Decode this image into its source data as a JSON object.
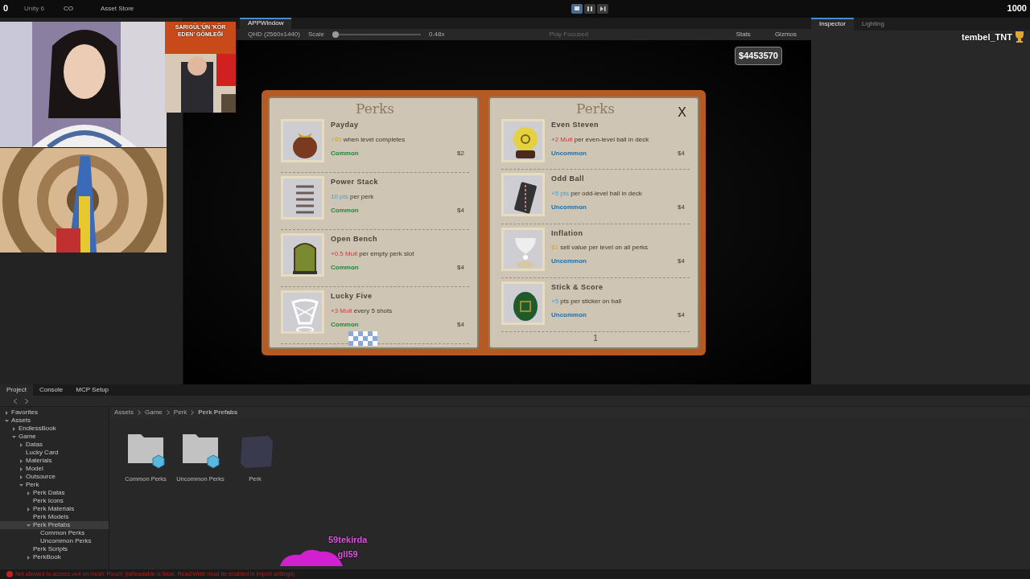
{
  "toolbar": {
    "product": "Unity 6",
    "account": "CO",
    "store": "Asset Store",
    "play_buttons": [
      {
        "selected": true
      },
      {
        "selected": false
      },
      {
        "selected": false
      }
    ]
  },
  "stream": {
    "left_counter": "0",
    "right_counter": "1000",
    "viewer": "tembel_TNT",
    "news_caption": "SARIGÜL'ÜN 'KÖR EDEN' GÖMLEĞİ",
    "follower_lines": [
      "59tekirda",
      "gll59"
    ]
  },
  "game_view": {
    "tab": "APPWindow",
    "resolution": "QHD (2560x1440)",
    "scale_label": "Scale",
    "scale": {
      "level": 0.0
    },
    "scale_reading": "0.48x",
    "play_mode": "Play Focused",
    "stats": "Stats",
    "gizmos": "Gizmos",
    "money": "$4453570"
  },
  "book": {
    "close": "X",
    "pages": [
      {
        "title": "Perks",
        "perks": [
          {
            "name": "Payday",
            "effect": {
              "kind": "money",
              "value": "+$5",
              "rest": " when level completes"
            },
            "rarity": "Common",
            "price": "$2"
          },
          {
            "name": "Power Stack",
            "effect": {
              "kind": "pts",
              "value": "10 pts",
              "rest": " per perk"
            },
            "rarity": "Common",
            "price": "$4"
          },
          {
            "name": "Open Bench",
            "effect": {
              "kind": "mult",
              "value": "+0.5 Mult",
              "rest": " per empty perk slot"
            },
            "rarity": "Common",
            "price": "$4"
          },
          {
            "name": "Lucky Five",
            "effect": {
              "kind": "mult",
              "value": "+3 Mult",
              "rest": " every 5 shots"
            },
            "rarity": "Common",
            "price": "$4"
          }
        ]
      },
      {
        "title": "Perks",
        "page_number": "1",
        "perks": [
          {
            "name": "Even Steven",
            "effect": {
              "kind": "mult",
              "value": "+2 Mult",
              "rest": " per even-level ball in deck"
            },
            "rarity": "Uncommon",
            "price": "$4"
          },
          {
            "name": "Odd Ball",
            "effect": {
              "kind": "pts",
              "value": "+5 pts",
              "rest": " per odd-level ball in deck"
            },
            "rarity": "Uncommon",
            "price": "$4"
          },
          {
            "name": "Inflation",
            "effect": {
              "kind": "money",
              "value": "$1",
              "rest": " sell value per level on all perks"
            },
            "rarity": "Uncommon",
            "price": "$4"
          },
          {
            "name": "Stick & Score",
            "effect": {
              "kind": "pts",
              "value": "+5",
              "rest": " pts per sticker on ball"
            },
            "rarity": "Uncommon",
            "price": "$4"
          }
        ]
      }
    ]
  },
  "inspector": {
    "tabs": [
      {
        "label": "Inspector",
        "selected": true
      },
      {
        "label": "Lighting",
        "selected": false
      }
    ]
  },
  "project": {
    "tabs": [
      {
        "label": "Project",
        "selected": true
      },
      {
        "label": "Console",
        "selected": false
      },
      {
        "label": "MCP Setup",
        "selected": false
      }
    ],
    "tree": [
      {
        "label": "Favorites",
        "expandable": true,
        "expanded": false,
        "selected": false
      },
      {
        "label": "Assets",
        "expandable": true,
        "expanded": true,
        "selected": false,
        "children": [
          {
            "label": "EndlessBook",
            "expandable": true,
            "expanded": false,
            "selected": false
          },
          {
            "label": "Game",
            "expandable": true,
            "expanded": true,
            "selected": false,
            "children": [
              {
                "label": "Datas",
                "expandable": true,
                "expanded": false,
                "selected": false
              },
              {
                "label": "Lucky Card",
                "expandable": false,
                "expanded": false,
                "selected": false
              },
              {
                "label": "Materials",
                "expandable": true,
                "expanded": false,
                "selected": false
              },
              {
                "label": "Model",
                "expandable": true,
                "expanded": false,
                "selected": false
              },
              {
                "label": "Outsource",
                "expandable": true,
                "expanded": false,
                "selected": false
              },
              {
                "label": "Perk",
                "expandable": true,
                "expanded": true,
                "selected": false,
                "children": [
                  {
                    "label": "Perk Datas",
                    "expandable": true,
                    "expanded": false,
                    "selected": false
                  },
                  {
                    "label": "Perk Icons",
                    "expandable": false,
                    "expanded": false,
                    "selected": false
                  },
                  {
                    "label": "Perk Materials",
                    "expandable": true,
                    "expanded": false,
                    "selected": false
                  },
                  {
                    "label": "Perk Models",
                    "expandable": false,
                    "expanded": false,
                    "selected": false
                  },
                  {
                    "label": "Perk Prefabs",
                    "expandable": true,
                    "expanded": true,
                    "selected": true,
                    "children": [
                      {
                        "label": "Common Perks",
                        "expandable": false,
                        "expanded": false,
                        "selected": false
                      },
                      {
                        "label": "Uncommon Perks",
                        "expandable": false,
                        "expanded": false,
                        "selected": false
                      }
                    ]
                  },
                  {
                    "label": "Perk Scripts",
                    "expandable": false,
                    "expanded": false,
                    "selected": false
                  },
                  {
                    "label": "PerkBook",
                    "expandable": true,
                    "expanded": false,
                    "selected": false
                  }
                ]
              }
            ]
          }
        ]
      }
    ],
    "breadcrumb": [
      "Assets",
      "Game",
      "Perk",
      "Perk Prefabs"
    ],
    "assets": [
      {
        "label": "Common Perks",
        "kind": "folder"
      },
      {
        "label": "Uncommon Perks",
        "kind": "folder"
      },
      {
        "label": "Perk",
        "kind": "prefab"
      }
    ]
  },
  "status_bar": {
    "message": "Not allowed to access uv4 on mesh 'Pouch' (isReadable is false; Read/Write must be enabled in import settings)"
  }
}
